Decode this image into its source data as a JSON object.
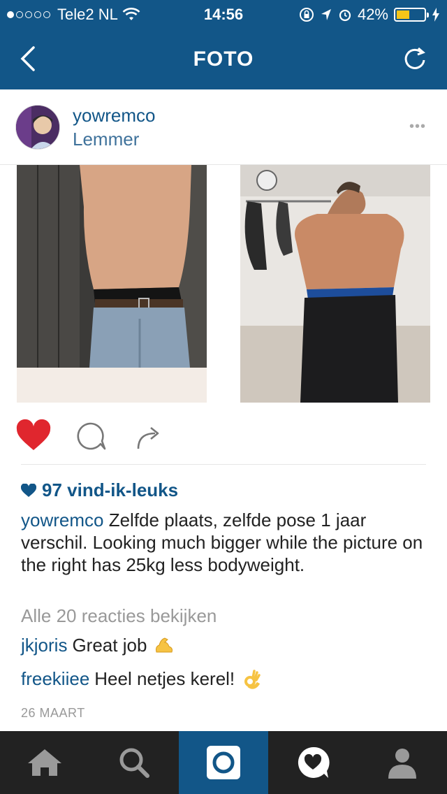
{
  "status_bar": {
    "carrier": "Tele2 NL",
    "time": "14:56",
    "battery": "42%"
  },
  "nav": {
    "title": "FOTO"
  },
  "post": {
    "username": "yowremco",
    "location": "Lemmer",
    "more": "•••",
    "likes": "97 vind-ik-leuks",
    "caption_user": "yowremco",
    "caption_text": "Zelfde plaats, zelfde pose 1 jaar verschil. Looking much bigger while the picture on the right has 25kg less bodyweight.",
    "view_all": "Alle 20 reacties bekijken",
    "comments": [
      {
        "user": "jkjoris",
        "text": "Great job",
        "emoji": "flexed-biceps"
      },
      {
        "user": "freekiiee",
        "text": "Heel netjes kerel!",
        "emoji": "ok-hand"
      }
    ],
    "date": "26 MAART",
    "liked": true
  },
  "colors": {
    "brand_blue": "#125688",
    "link_blue": "#3f729b",
    "like_red": "#e0262e",
    "tabbar_bg": "#222222"
  },
  "tabs": [
    {
      "name": "home",
      "active": false
    },
    {
      "name": "search",
      "active": false
    },
    {
      "name": "camera",
      "active": true
    },
    {
      "name": "activity",
      "active": false
    },
    {
      "name": "profile",
      "active": false
    }
  ]
}
